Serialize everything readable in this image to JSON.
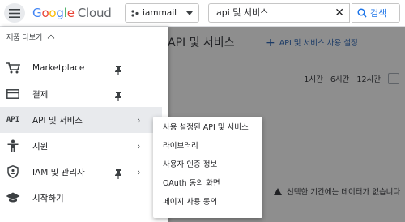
{
  "header": {
    "logo_letters": [
      "G",
      "o",
      "o",
      "g",
      "l",
      "e"
    ],
    "logo_product": "Cloud",
    "project_name": "iammail",
    "search_value": "api 및 서비스",
    "search_button": "검색"
  },
  "main": {
    "title": "API 및 서비스",
    "enable_label": "API 및 서비스 사용 설정",
    "time_ranges": [
      "1시간",
      "6시간",
      "12시간"
    ],
    "warning_text": "선택한 기간에는 데이터가 없습니다"
  },
  "sidebar": {
    "collapse_label": "제품 더보기",
    "items": [
      {
        "label": "Marketplace",
        "icon": "cart-icon",
        "pinned": true
      },
      {
        "label": "결제",
        "icon": "billing-icon",
        "pinned": true
      },
      {
        "label": "API 및 서비스",
        "icon": "api-icon",
        "active": true,
        "submenu": true
      },
      {
        "label": "지원",
        "icon": "support-icon",
        "submenu": true
      },
      {
        "label": "IAM 및 관리자",
        "icon": "shield-icon",
        "pinned": true,
        "submenu": true
      },
      {
        "label": "시작하기",
        "icon": "school-icon"
      }
    ],
    "api_icon_text": "API"
  },
  "submenu": {
    "items": [
      "사용 설정된 API 및 서비스",
      "라이브러리",
      "사용자 인증 정보",
      "OAuth 동의 화면",
      "페이지 사용 동의"
    ]
  },
  "colors": {
    "accent": "#1a73e8",
    "overlay": "#8e8e8e",
    "active_item": "#e8eaed"
  }
}
